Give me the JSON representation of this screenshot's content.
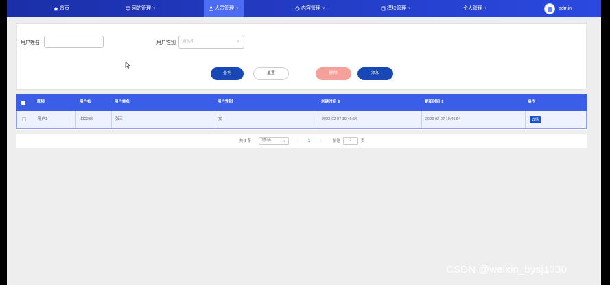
{
  "nav": {
    "items": [
      {
        "label": "首页",
        "icon": "home-icon"
      },
      {
        "label": "网站管理",
        "icon": "monitor-icon"
      },
      {
        "label": "人员管理",
        "icon": "user-icon",
        "active": true
      },
      {
        "label": "内容管理",
        "icon": "chat-icon"
      },
      {
        "label": "模块管理",
        "icon": "module-icon"
      },
      {
        "label": "个人管理",
        "icon": ""
      }
    ],
    "user_name": "admin"
  },
  "filter": {
    "name_label": "用户姓名",
    "name_value": "",
    "gender_label": "用户性别",
    "gender_placeholder": "请选择",
    "query_label": "查询",
    "reset_label": "重置",
    "delete_label": "删除",
    "add_label": "添加"
  },
  "table": {
    "headers": [
      "昵称",
      "用户名",
      "用户姓名",
      "用户性别",
      "创建时间 ⇕",
      "更新时间 ⇕",
      "操作"
    ],
    "rows": [
      {
        "nickname": "用户1",
        "username": "112233",
        "realname": "张三",
        "gender": "女",
        "created": "2023-02-07 10:46:54",
        "updated": "2023-02-07 10:46:54",
        "action": "详情"
      }
    ]
  },
  "pager": {
    "total": "共 1 条",
    "page_size": "7条/页",
    "current_page": "1",
    "goto_label": "前往",
    "goto_value": "1",
    "page_suffix": "页"
  },
  "watermark": "CSDN @weixin_bysj1330",
  "colors": {
    "nav_bg": "#2b49e0",
    "table_header": "#3a5ee8",
    "primary_button": "#1748b6",
    "danger_button": "#f5a09a"
  }
}
